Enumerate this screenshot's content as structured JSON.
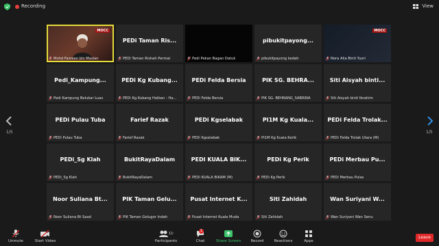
{
  "topbar": {
    "recording_label": "Recording",
    "view_label": "View"
  },
  "pager": {
    "left_label": "1/5",
    "right_label": "1/5"
  },
  "tiles": [
    {
      "big": "",
      "foot": "Mohd Fazreen bin Maslan",
      "kind": "video",
      "active": true,
      "badge": "MOCC"
    },
    {
      "big": "PEDi Taman Ris...",
      "foot": "PEDi Taman Rishah Permai"
    },
    {
      "big": "",
      "foot": "Pedi Pekan Bagan Datuk",
      "kind": "black"
    },
    {
      "big": "pibukitpayong...",
      "foot": "pibukitpayong kedah"
    },
    {
      "big": "",
      "foot": "Nora Alia Binti Yusri",
      "kind": "darkblue",
      "badge": "MOCC"
    },
    {
      "big": "Pedi_Kampung...",
      "foot": "Pedi Kampung Belukar Luas"
    },
    {
      "big": "PEDi Kg Kubang...",
      "foot": "PEDi Kg Kubang Halban - Ha..."
    },
    {
      "big": "PEDi Felda Bersia",
      "foot": "PEDi Felda Bersia"
    },
    {
      "big": "PIK SG. BEHRA...",
      "foot": "PIK SG. BEHRANG_SABRINA"
    },
    {
      "big": "Siti Aisyah binti...",
      "foot": "Siti Aisyah binti Ibrahim"
    },
    {
      "big": "PEDi Pulau Tuba",
      "foot": "PEDi Pulau Tuba"
    },
    {
      "big": "Farief Razak",
      "foot": "Farief Razak"
    },
    {
      "big": "PEDi Kgselabak",
      "foot": "PEDi Kgselabak"
    },
    {
      "big": "PI1M Kg Kuala...",
      "foot": "PI1M Kg Kuala Kerik"
    },
    {
      "big": "PEDi Felda Trolak...",
      "foot": "PEDi Felda Trolak Utara (M)"
    },
    {
      "big": "PEDi_Sg Klah",
      "foot": "PEDi_Sg Klah"
    },
    {
      "big": "BukitRayaDalam",
      "foot": "BukitRayaDalam"
    },
    {
      "big": "PEDI KUALA BIK...",
      "foot": "PEDI KUALA BIKAM (M)"
    },
    {
      "big": "PEDi Kg Perik",
      "foot": "PEDi Kg Perik"
    },
    {
      "big": "PEDi Merbau Pu...",
      "foot": "PEDi Merbau Pulas"
    },
    {
      "big": "Noor Suliana Bt...",
      "foot": "Noor Suliana Bt Saad"
    },
    {
      "big": "PIK Taman Gelu...",
      "foot": "PIK Taman Gelugor Indah"
    },
    {
      "big": "Pusat Internet K...",
      "foot": "Pusat Internet Kuala Muda"
    },
    {
      "big": "Siti Zahidah",
      "foot": "Siti Zahidah"
    },
    {
      "big": "Wan Suriyani W...",
      "foot": "Wan Suriyani Wan Senu"
    }
  ],
  "toolbar": {
    "unmute": "Unmute",
    "start_video": "Start Video",
    "participants": "Participants",
    "participants_count": "110",
    "chat": "Chat",
    "chat_badge": "1",
    "share_screen": "Share Screen",
    "record": "Record",
    "reactions": "Reactions",
    "apps": "Apps",
    "leave": "Leave"
  },
  "colors": {
    "share_green": "#3cc36b",
    "leave_red": "#e02828",
    "active_border": "#e6de3a"
  }
}
